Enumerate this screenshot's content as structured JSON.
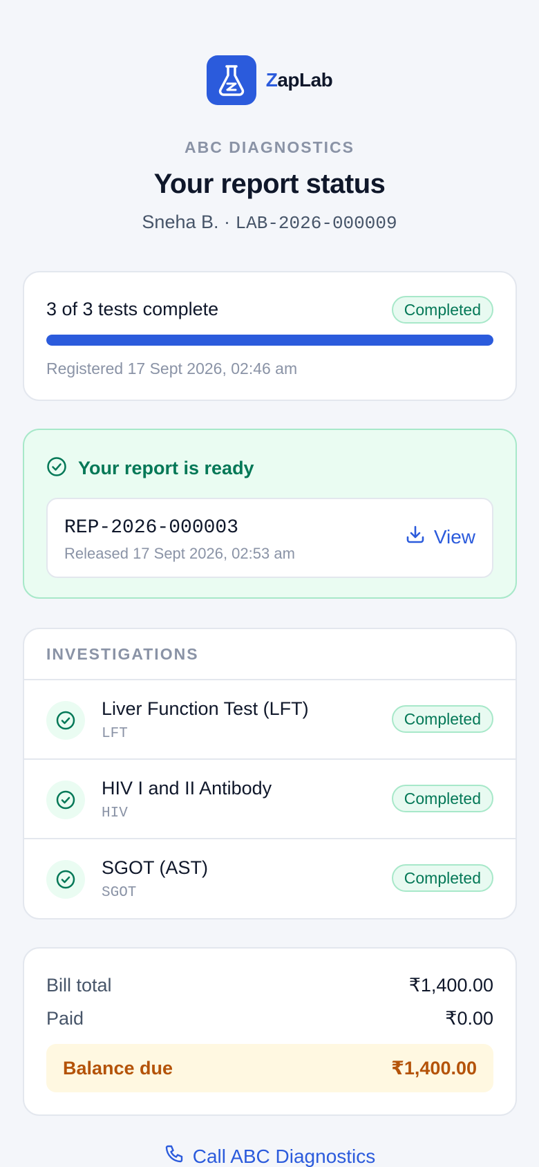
{
  "brand": {
    "name_prefix": "Z",
    "name_rest": "apLab",
    "accent": "#2b5bdc",
    "icon": "flask-icon"
  },
  "header": {
    "lab_name": "ABC DIAGNOSTICS",
    "title": "Your report status",
    "patient_name": "Sneha B.",
    "separator": " · ",
    "lab_id": "LAB-2026-000009"
  },
  "progress": {
    "summary": "3 of 3 tests complete",
    "status": "Completed",
    "fraction": 1.0,
    "registered": "Registered 17 Sept 2026, 02:46 am"
  },
  "report": {
    "heading": "Your report is ready",
    "id": "REP-2026-000003",
    "released": "Released 17 Sept 2026, 02:53 am",
    "view_label": "View"
  },
  "investigations": {
    "heading": "INVESTIGATIONS",
    "items": [
      {
        "name": "Liver Function Test (LFT)",
        "code": "LFT",
        "status": "Completed"
      },
      {
        "name": "HIV I and II Antibody",
        "code": "HIV",
        "status": "Completed"
      },
      {
        "name": "SGOT (AST)",
        "code": "SGOT",
        "status": "Completed"
      }
    ]
  },
  "bill": {
    "total_label": "Bill total",
    "total_value": "₹1,400.00",
    "paid_label": "Paid",
    "paid_value": "₹0.00",
    "balance_label": "Balance due",
    "balance_value": "₹1,400.00"
  },
  "call": {
    "label": "Call ABC Diagnostics",
    "icon": "phone-icon"
  },
  "colors": {
    "success": "#047857",
    "warning": "#b45309",
    "primary": "#2b5bdc"
  }
}
